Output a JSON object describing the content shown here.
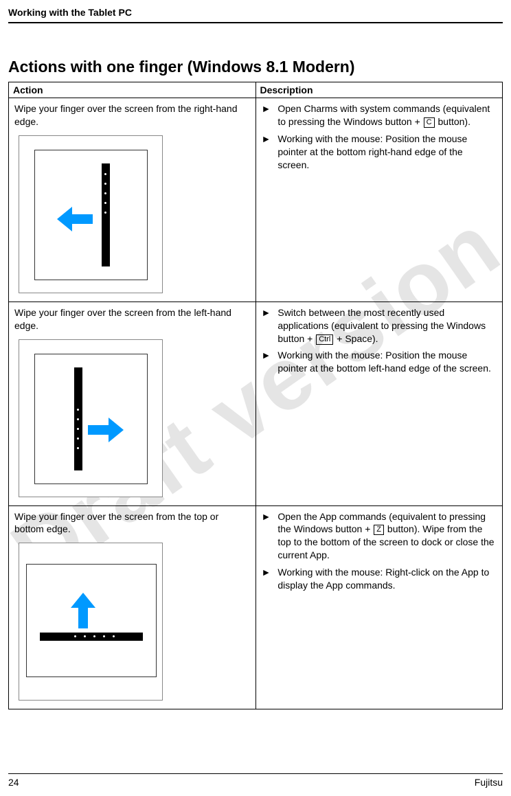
{
  "header": {
    "title": "Working with the Tablet PC"
  },
  "watermark": "Draft version",
  "section": {
    "heading": "Actions with one finger (Windows 8.1 Modern)"
  },
  "table": {
    "headers": {
      "action": "Action",
      "description": "Description"
    },
    "rows": [
      {
        "action_text": "Wipe your finger over the screen from the right-hand edge.",
        "desc": [
          {
            "parts": [
              {
                "t": "text",
                "v": "Open Charms with system commands (equivalent to pressing the Windows button + "
              },
              {
                "t": "key",
                "v": "C"
              },
              {
                "t": "text",
                "v": " button)."
              }
            ]
          },
          {
            "parts": [
              {
                "t": "text",
                "v": "Working with the mouse: Position the mouse pointer at the bottom right-hand edge of the screen."
              }
            ]
          }
        ]
      },
      {
        "action_text": "Wipe your finger over the screen from the left-hand edge.",
        "desc": [
          {
            "parts": [
              {
                "t": "text",
                "v": "Switch between the most recently used applications (equivalent to pressing the Windows button + "
              },
              {
                "t": "key",
                "v": "Ctrl"
              },
              {
                "t": "text",
                "v": " + Space)."
              }
            ]
          },
          {
            "parts": [
              {
                "t": "text",
                "v": "Working with the mouse: Position the mouse pointer at the bottom left-hand edge of the screen."
              }
            ]
          }
        ]
      },
      {
        "action_text": "Wipe your finger over the screen from the top or bottom edge.",
        "desc": [
          {
            "parts": [
              {
                "t": "text",
                "v": "Open the App commands (equivalent to pressing the Windows button + "
              },
              {
                "t": "key",
                "v": "Z"
              },
              {
                "t": "text",
                "v": " button). Wipe from the top to the bottom of the screen to dock or close the current App."
              }
            ]
          },
          {
            "parts": [
              {
                "t": "text",
                "v": "Working with the mouse: Right-click on the App to display the App commands."
              }
            ]
          }
        ]
      }
    ]
  },
  "footer": {
    "page": "24",
    "brand": "Fujitsu"
  }
}
